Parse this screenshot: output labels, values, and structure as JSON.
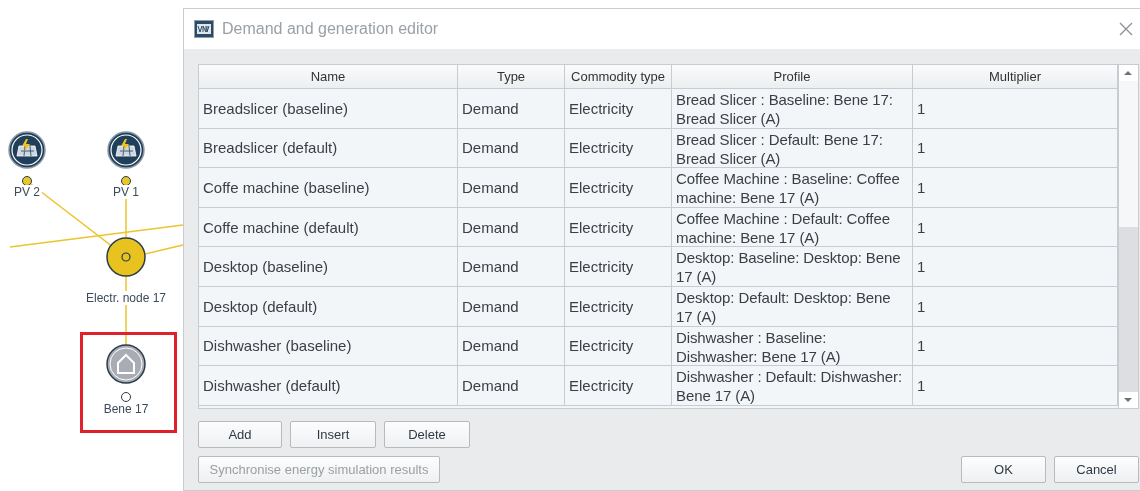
{
  "diagram": {
    "nodes": [
      {
        "kind": "pv",
        "label": "PV 2",
        "selected": false
      },
      {
        "kind": "pv",
        "label": "PV 1",
        "selected": false
      },
      {
        "kind": "junction",
        "label": "Electr. node 17",
        "selected": false
      },
      {
        "kind": "building",
        "label": "Bene 17",
        "selected": true
      }
    ]
  },
  "window": {
    "title": "Demand and generation editor"
  },
  "table": {
    "columns": [
      "Name",
      "Type",
      "Commodity type",
      "Profile",
      "Multiplier"
    ],
    "rows": [
      [
        "Breadslicer (baseline)",
        "Demand",
        "Electricity",
        "Bread Slicer : Baseline: Bene 17: Bread Slicer (A)",
        "1"
      ],
      [
        "Breadslicer (default)",
        "Demand",
        "Electricity",
        "Bread Slicer : Default: Bene 17: Bread Slicer (A)",
        "1"
      ],
      [
        "Coffe machine (baseline)",
        "Demand",
        "Electricity",
        "Coffee Machine : Baseline: Coffee machine: Bene 17 (A)",
        "1"
      ],
      [
        "Coffe machine (default)",
        "Demand",
        "Electricity",
        "Coffee Machine : Default: Coffee machine: Bene 17 (A)",
        "1"
      ],
      [
        "Desktop (baseline)",
        "Demand",
        "Electricity",
        "Desktop: Baseline: Desktop: Bene 17 (A)",
        "1"
      ],
      [
        "Desktop (default)",
        "Demand",
        "Electricity",
        "Desktop: Default: Desktop: Bene 17 (A)",
        "1"
      ],
      [
        "Dishwasher (baseline)",
        "Demand",
        "Electricity",
        "Dishwasher : Baseline: Dishwasher: Bene 17 (A)",
        "1"
      ],
      [
        "Dishwasher (default)",
        "Demand",
        "Electricity",
        "Dishwasher : Default: Dishwasher: Bene 17 (A)",
        "1"
      ]
    ]
  },
  "row_buttons": [
    {
      "label": "Add",
      "disabled": false
    },
    {
      "label": "Insert",
      "disabled": false
    },
    {
      "label": "Delete",
      "disabled": false
    }
  ],
  "sync_button": {
    "label": "Synchronise energy simulation results",
    "disabled": true
  },
  "dialog_buttons": [
    {
      "label": "OK",
      "disabled": false
    },
    {
      "label": "Cancel",
      "disabled": false
    }
  ]
}
